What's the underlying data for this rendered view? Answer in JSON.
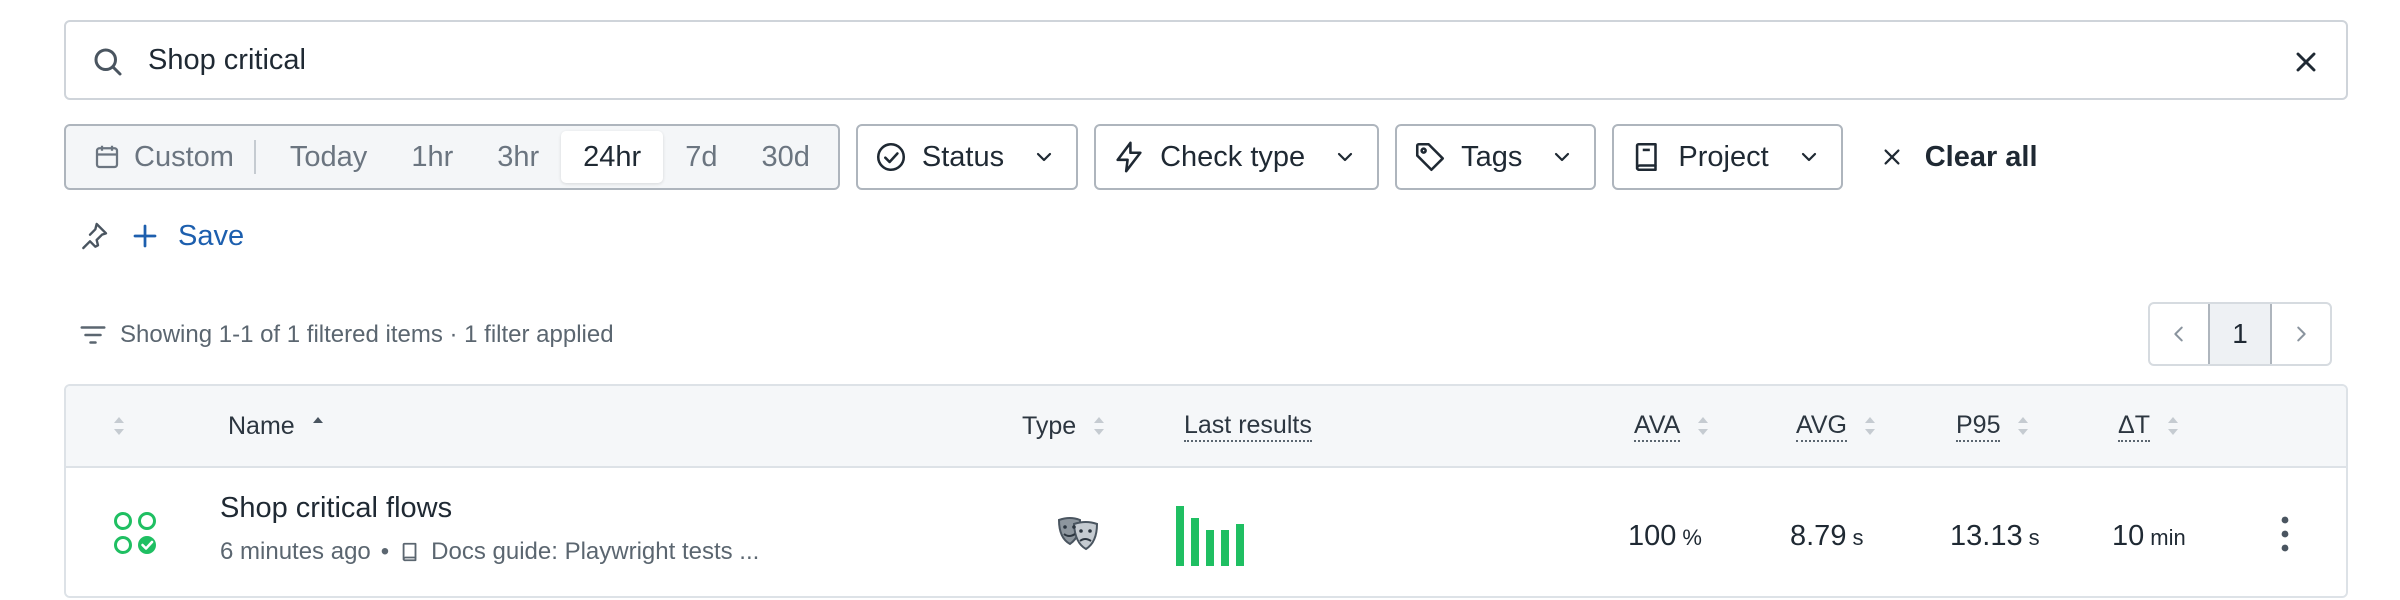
{
  "search": {
    "value": "Shop critical"
  },
  "time_range": {
    "custom_label": "Custom",
    "options": [
      "Today",
      "1hr",
      "3hr",
      "24hr",
      "7d",
      "30d"
    ],
    "selected": "24hr"
  },
  "filters": {
    "status": "Status",
    "check_type": "Check type",
    "tags": "Tags",
    "project": "Project",
    "clear_all": "Clear all"
  },
  "save_label": "Save",
  "summary": "Showing 1-1 of 1 filtered items · 1 filter applied",
  "pagination": {
    "current": "1"
  },
  "table": {
    "headers": {
      "name": "Name",
      "type": "Type",
      "last_results": "Last results",
      "ava": "AVA",
      "avg": "AVG",
      "p95": "P95",
      "dt": "ΔT"
    },
    "rows": [
      {
        "name": "Shop critical flows",
        "time_ago": "6 minutes ago",
        "project": "Docs guide: Playwright tests ...",
        "type_icon": "playwright-masks-icon",
        "last_results": [
          1.0,
          0.8,
          0.6,
          0.6,
          0.7
        ],
        "ava": {
          "value": "100",
          "unit": "%"
        },
        "avg": {
          "value": "8.79",
          "unit": "s"
        },
        "p95": {
          "value": "13.13",
          "unit": "s"
        },
        "dt": {
          "value": "10",
          "unit": "min"
        }
      }
    ]
  },
  "colors": {
    "accent": "#1d5fae",
    "success": "#1fbf62",
    "border": "#aeb5bd"
  }
}
